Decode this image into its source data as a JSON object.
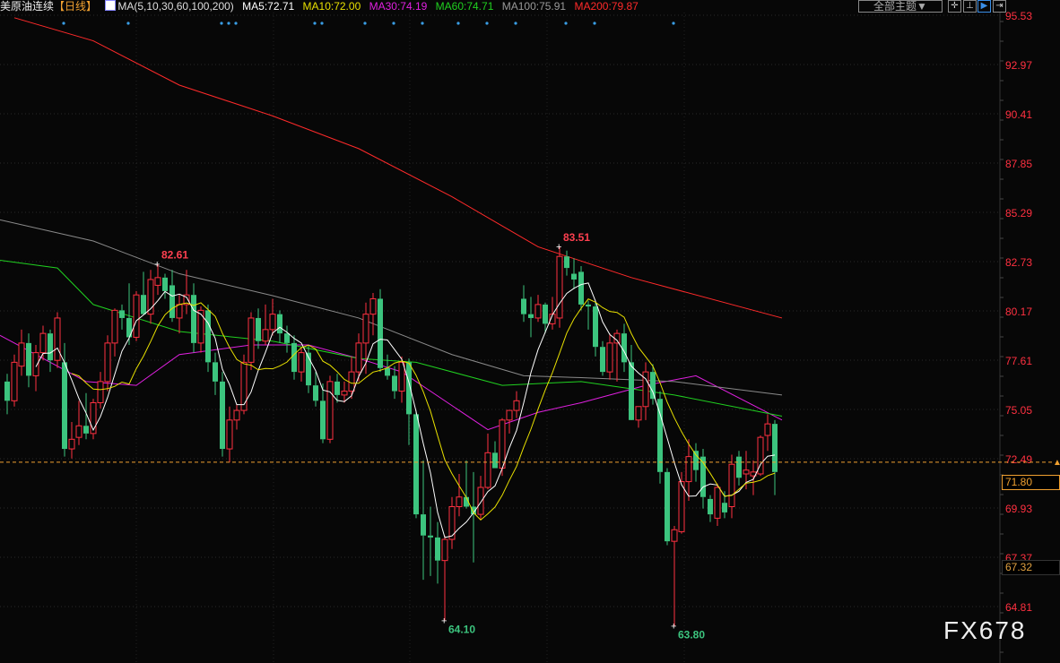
{
  "header": {
    "instrument": "美原油连续",
    "period": "【日线】",
    "ma_label": "MA(5,10,30,60,100,200)",
    "ma5": "MA5:72.71",
    "ma10": "MA10:72.00",
    "ma30": "MA30:74.19",
    "ma60": "MA60:74.71",
    "ma100": "MA100:75.91",
    "ma200": "MA200:79.87"
  },
  "toolbar": {
    "theme_label": "全部主题▼",
    "icons": [
      "crosshair-icon",
      "axis-icon",
      "play-icon",
      "exit-icon"
    ]
  },
  "colors": {
    "up": "#ff3040",
    "down": "#3cc47e",
    "ma5": "#ffffff",
    "ma10": "#e8e000",
    "ma30": "#e020e0",
    "ma60": "#20d020",
    "ma100": "#8a8a8a",
    "ma200": "#ff2a2a",
    "axis_text": "#ff3040",
    "current": "#f0a030"
  },
  "current_price": "71.80",
  "prev_price": "67.32",
  "watermark": "FX678",
  "chart_data": {
    "type": "candlestick",
    "title": "美原油连续 日线",
    "ylim": [
      64.81,
      95.53
    ],
    "yticks": [
      "95.53",
      "92.97",
      "90.41",
      "87.85",
      "85.29",
      "82.73",
      "80.17",
      "77.61",
      "75.05",
      "72.49",
      "69.93",
      "67.37",
      "64.81"
    ],
    "annotations": [
      {
        "text": "82.61",
        "index": 21,
        "type": "high"
      },
      {
        "text": "83.51",
        "index": 77,
        "type": "high"
      },
      {
        "text": "64.10",
        "index": 61,
        "type": "low"
      },
      {
        "text": "63.80",
        "index": 93,
        "type": "low"
      }
    ],
    "event_marker_indices": [
      8,
      17,
      30,
      31,
      32,
      43,
      44,
      50,
      54,
      58,
      63,
      67,
      71,
      78,
      82,
      93
    ],
    "ohlc": [
      [
        76.5,
        76.9,
        74.8,
        75.5
      ],
      [
        75.5,
        77.9,
        75.2,
        77.5
      ],
      [
        77.3,
        79.2,
        76.8,
        78.5
      ],
      [
        78.5,
        79.0,
        76.2,
        76.8
      ],
      [
        76.8,
        78.4,
        76.0,
        78.0
      ],
      [
        78.0,
        79.4,
        77.6,
        79.0
      ],
      [
        79.0,
        79.2,
        77.0,
        77.6
      ],
      [
        77.6,
        80.1,
        77.2,
        79.8
      ],
      [
        77.5,
        78.5,
        72.6,
        73.0
      ],
      [
        73.0,
        74.4,
        72.5,
        73.5
      ],
      [
        73.6,
        75.5,
        73.2,
        74.2
      ],
      [
        74.2,
        75.9,
        73.5,
        73.8
      ],
      [
        73.8,
        75.6,
        73.5,
        75.4
      ],
      [
        75.4,
        77.0,
        75.1,
        76.5
      ],
      [
        76.5,
        78.9,
        76.0,
        78.5
      ],
      [
        78.5,
        80.3,
        77.8,
        80.2
      ],
      [
        80.2,
        80.5,
        79.2,
        79.8
      ],
      [
        79.8,
        81.6,
        78.4,
        78.8
      ],
      [
        78.8,
        81.2,
        78.6,
        81.0
      ],
      [
        81.0,
        82.2,
        80.1,
        80.0
      ],
      [
        80.0,
        82.3,
        79.5,
        81.8
      ],
      [
        81.5,
        82.61,
        81.0,
        81.9
      ],
      [
        81.9,
        82.1,
        80.8,
        81.2
      ],
      [
        81.5,
        82.3,
        79.6,
        79.8
      ],
      [
        79.8,
        81.0,
        79.0,
        80.5
      ],
      [
        80.5,
        82.3,
        80.0,
        81.0
      ],
      [
        81.0,
        81.6,
        78.0,
        78.5
      ],
      [
        78.5,
        80.4,
        78.0,
        80.2
      ],
      [
        80.2,
        80.5,
        77.0,
        77.5
      ],
      [
        77.5,
        78.0,
        75.8,
        76.5
      ],
      [
        76.5,
        77.0,
        72.6,
        73.0
      ],
      [
        73.0,
        75.2,
        72.3,
        74.5
      ],
      [
        74.5,
        75.3,
        74.0,
        75.0
      ],
      [
        75.0,
        77.9,
        74.8,
        77.5
      ],
      [
        77.5,
        80.1,
        77.1,
        79.8
      ],
      [
        79.8,
        80.3,
        78.2,
        78.6
      ],
      [
        78.6,
        80.5,
        78.4,
        79.2
      ],
      [
        79.2,
        80.8,
        78.9,
        80.0
      ],
      [
        80.0,
        80.2,
        78.5,
        79.0
      ],
      [
        79.0,
        79.4,
        78.0,
        78.5
      ],
      [
        78.5,
        78.9,
        76.6,
        77.0
      ],
      [
        77.0,
        78.3,
        76.5,
        78.0
      ],
      [
        78.0,
        78.4,
        75.9,
        76.3
      ],
      [
        76.3,
        77.0,
        75.2,
        75.5
      ],
      [
        75.5,
        76.4,
        73.3,
        73.5
      ],
      [
        73.5,
        76.8,
        73.3,
        76.5
      ],
      [
        76.5,
        76.9,
        75.4,
        75.8
      ],
      [
        75.8,
        76.5,
        75.4,
        76.0
      ],
      [
        76.0,
        77.8,
        75.6,
        77.0
      ],
      [
        77.0,
        79.0,
        76.5,
        78.5
      ],
      [
        78.5,
        80.6,
        76.9,
        80.0
      ],
      [
        80.0,
        81.1,
        78.9,
        80.8
      ],
      [
        80.8,
        81.3,
        77.0,
        77.2
      ],
      [
        77.2,
        77.9,
        76.6,
        76.8
      ],
      [
        76.8,
        77.3,
        75.6,
        76.0
      ],
      [
        76.0,
        77.8,
        75.4,
        77.5
      ],
      [
        77.5,
        77.7,
        73.2,
        74.8
      ],
      [
        74.8,
        75.0,
        69.4,
        69.6
      ],
      [
        69.6,
        72.4,
        66.2,
        68.5
      ],
      [
        68.5,
        70.0,
        66.4,
        68.4
      ],
      [
        68.4,
        69.2,
        66.0,
        67.2
      ],
      [
        67.2,
        68.5,
        64.1,
        68.3
      ],
      [
        68.3,
        70.5,
        67.8,
        70.0
      ],
      [
        70.0,
        71.7,
        69.5,
        70.5
      ],
      [
        70.5,
        72.4,
        69.9,
        70.0
      ],
      [
        70.0,
        71.8,
        67.1,
        69.6
      ],
      [
        69.6,
        71.6,
        69.3,
        71.0
      ],
      [
        71.0,
        73.8,
        70.9,
        72.8
      ],
      [
        72.8,
        73.4,
        72.0,
        72.0
      ],
      [
        72.0,
        74.6,
        71.6,
        74.5
      ],
      [
        74.5,
        74.9,
        73.8,
        75.0
      ],
      [
        75.0,
        76.0,
        74.6,
        75.5
      ],
      [
        80.8,
        81.5,
        79.6,
        80.0
      ],
      [
        80.0,
        80.9,
        78.8,
        79.8
      ],
      [
        79.8,
        81.0,
        79.6,
        80.5
      ],
      [
        80.5,
        80.6,
        79.0,
        79.5
      ],
      [
        79.5,
        80.9,
        79.2,
        80.0
      ],
      [
        79.8,
        83.51,
        79.3,
        83.0
      ],
      [
        83.0,
        83.3,
        82.0,
        82.4
      ],
      [
        82.1,
        82.9,
        81.3,
        81.8
      ],
      [
        82.2,
        82.5,
        80.2,
        80.5
      ],
      [
        80.5,
        80.7,
        79.2,
        80.4
      ],
      [
        80.4,
        80.6,
        77.8,
        78.3
      ],
      [
        78.3,
        78.6,
        76.8,
        77.0
      ],
      [
        77.0,
        79.0,
        76.6,
        78.5
      ],
      [
        78.5,
        79.2,
        76.5,
        79.0
      ],
      [
        79.0,
        79.5,
        77.0,
        77.5
      ],
      [
        77.5,
        78.4,
        74.8,
        74.5
      ],
      [
        74.5,
        75.2,
        74.1,
        75.2
      ],
      [
        75.2,
        77.5,
        74.5,
        77.0
      ],
      [
        77.0,
        77.4,
        75.3,
        75.6
      ],
      [
        75.6,
        76.0,
        71.2,
        71.8
      ],
      [
        71.8,
        72.0,
        68.0,
        68.2
      ],
      [
        68.2,
        69.0,
        63.8,
        68.8
      ],
      [
        68.7,
        71.8,
        68.6,
        71.3
      ],
      [
        71.3,
        73.5,
        70.3,
        72.6
      ],
      [
        72.9,
        73.3,
        71.3,
        71.9
      ],
      [
        72.6,
        73.0,
        69.9,
        70.5
      ],
      [
        70.4,
        70.6,
        69.2,
        69.6
      ],
      [
        69.4,
        71.2,
        69.0,
        71.0
      ],
      [
        70.2,
        70.8,
        69.4,
        69.7
      ],
      [
        70.0,
        72.7,
        69.4,
        72.2
      ],
      [
        72.6,
        72.9,
        71.1,
        71.5
      ],
      [
        71.7,
        72.9,
        70.9,
        71.9
      ],
      [
        71.6,
        72.4,
        70.6,
        71.8
      ],
      [
        71.7,
        73.7,
        71.6,
        73.6
      ],
      [
        73.7,
        74.8,
        72.9,
        74.3
      ],
      [
        74.3,
        74.5,
        70.6,
        71.8
      ]
    ],
    "series_ma_long": [
      {
        "name": "MA30",
        "points": [
          [
            -1,
            78.9
          ],
          [
            5,
            77.7
          ],
          [
            11,
            76.5
          ],
          [
            18,
            76.3
          ],
          [
            24,
            77.9
          ],
          [
            34,
            78.4
          ],
          [
            42,
            78.4
          ],
          [
            49,
            77.7
          ],
          [
            55,
            77.0
          ],
          [
            67,
            74.0
          ],
          [
            74,
            74.9
          ],
          [
            80,
            75.4
          ],
          [
            89,
            76.3
          ],
          [
            96,
            76.8
          ],
          [
            108,
            74.5
          ]
        ]
      },
      {
        "name": "MA60",
        "points": [
          [
            -1,
            82.8
          ],
          [
            7,
            82.4
          ],
          [
            12,
            80.5
          ],
          [
            24,
            79.1
          ],
          [
            37,
            78.6
          ],
          [
            49,
            77.7
          ],
          [
            57,
            77.5
          ],
          [
            69,
            76.3
          ],
          [
            80,
            76.5
          ],
          [
            93,
            75.8
          ],
          [
            108,
            74.7
          ]
        ]
      },
      {
        "name": "MA100",
        "points": [
          [
            -1,
            84.9
          ],
          [
            12,
            83.8
          ],
          [
            24,
            82.1
          ],
          [
            37,
            80.96
          ],
          [
            49,
            79.8
          ],
          [
            62,
            77.9
          ],
          [
            72,
            76.8
          ],
          [
            80,
            76.7
          ],
          [
            93,
            76.5
          ],
          [
            108,
            75.8
          ]
        ]
      },
      {
        "name": "MA200",
        "points": [
          [
            1,
            95.4
          ],
          [
            12,
            94.2
          ],
          [
            24,
            91.9
          ],
          [
            37,
            90.3
          ],
          [
            49,
            88.6
          ],
          [
            62,
            86.1
          ],
          [
            74,
            83.5
          ],
          [
            87,
            81.9
          ],
          [
            108,
            79.8
          ]
        ]
      }
    ]
  }
}
